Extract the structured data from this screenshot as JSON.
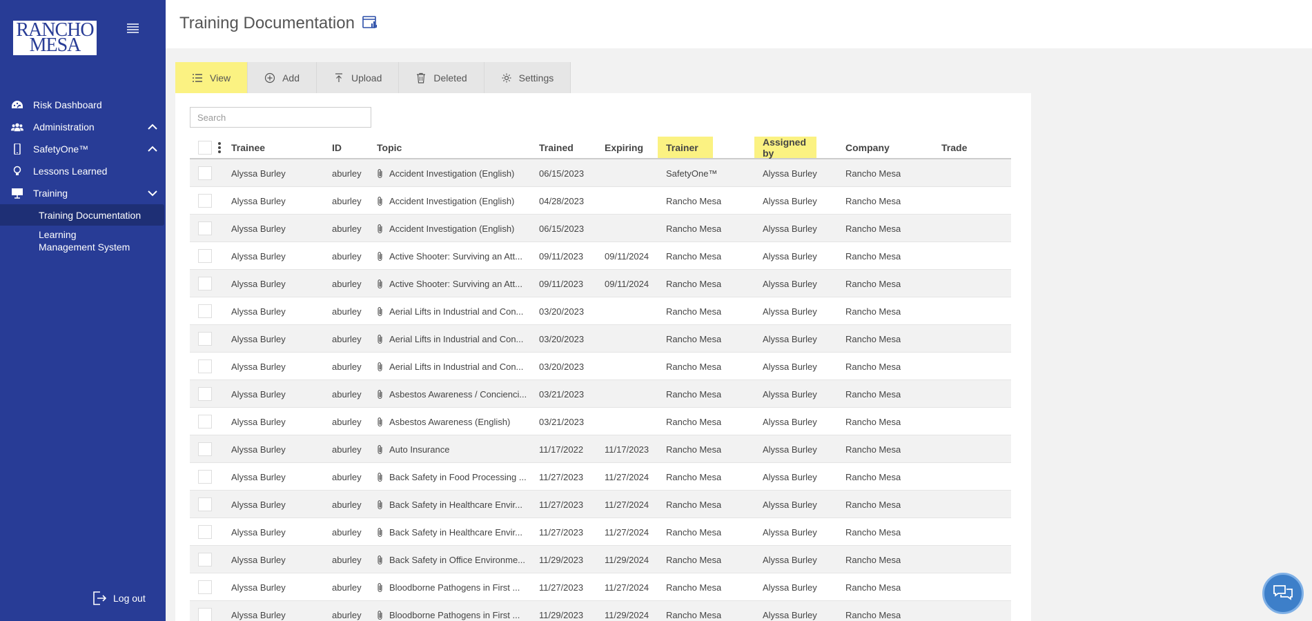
{
  "logo": {
    "line1": "RANCHO",
    "line2": "MESA"
  },
  "sidebar": {
    "items": [
      {
        "label": "Risk Dashboard",
        "icon": "dashboard-icon"
      },
      {
        "label": "Administration",
        "icon": "users-icon",
        "expanded": true
      },
      {
        "label": "SafetyOne™",
        "icon": "phone-icon",
        "expanded": true
      },
      {
        "label": "Lessons Learned",
        "icon": "lightbulb-icon"
      },
      {
        "label": "Training",
        "icon": "presentation-icon",
        "expanded": false
      }
    ],
    "training_sub": [
      {
        "label": "Training Documentation",
        "active": true
      },
      {
        "label": "Learning Management System",
        "active": false
      }
    ],
    "logout": "Log out"
  },
  "header": {
    "title": "Training Documentation"
  },
  "tabs": [
    {
      "label": "View",
      "icon": "list-icon",
      "active": true
    },
    {
      "label": "Add",
      "icon": "plus-circle-icon",
      "active": false
    },
    {
      "label": "Upload",
      "icon": "upload-icon",
      "active": false
    },
    {
      "label": "Deleted",
      "icon": "trash-icon",
      "active": false
    },
    {
      "label": "Settings",
      "icon": "gear-icon",
      "active": false
    }
  ],
  "search": {
    "placeholder": "Search",
    "value": ""
  },
  "table": {
    "columns": [
      "Trainee",
      "ID",
      "Topic",
      "Trained",
      "Expiring",
      "Trainer",
      "Assigned by",
      "Company",
      "Trade"
    ],
    "highlighted_columns": [
      "Trainer",
      "Assigned by"
    ],
    "highlight_color": "#fbf282",
    "rows": [
      [
        "Alyssa Burley",
        "aburley",
        "Accident Investigation (English)",
        "06/15/2023",
        "",
        "SafetyOne™",
        "Alyssa Burley",
        "Rancho Mesa",
        ""
      ],
      [
        "Alyssa Burley",
        "aburley",
        "Accident Investigation (English)",
        "04/28/2023",
        "",
        "Rancho Mesa",
        "Alyssa Burley",
        "Rancho Mesa",
        ""
      ],
      [
        "Alyssa Burley",
        "aburley",
        "Accident Investigation (English)",
        "06/15/2023",
        "",
        "Rancho Mesa",
        "Alyssa Burley",
        "Rancho Mesa",
        ""
      ],
      [
        "Alyssa Burley",
        "aburley",
        "Active Shooter: Surviving an Att...",
        "09/11/2023",
        "09/11/2024",
        "Rancho Mesa",
        "Alyssa Burley",
        "Rancho Mesa",
        ""
      ],
      [
        "Alyssa Burley",
        "aburley",
        "Active Shooter: Surviving an Att...",
        "09/11/2023",
        "09/11/2024",
        "Rancho Mesa",
        "Alyssa Burley",
        "Rancho Mesa",
        ""
      ],
      [
        "Alyssa Burley",
        "aburley",
        "Aerial Lifts in Industrial and Con...",
        "03/20/2023",
        "",
        "Rancho Mesa",
        "Alyssa Burley",
        "Rancho Mesa",
        ""
      ],
      [
        "Alyssa Burley",
        "aburley",
        "Aerial Lifts in Industrial and Con...",
        "03/20/2023",
        "",
        "Rancho Mesa",
        "Alyssa Burley",
        "Rancho Mesa",
        ""
      ],
      [
        "Alyssa Burley",
        "aburley",
        "Aerial Lifts in Industrial and Con...",
        "03/20/2023",
        "",
        "Rancho Mesa",
        "Alyssa Burley",
        "Rancho Mesa",
        ""
      ],
      [
        "Alyssa Burley",
        "aburley",
        "Asbestos Awareness / Concienci...",
        "03/21/2023",
        "",
        "Rancho Mesa",
        "Alyssa Burley",
        "Rancho Mesa",
        ""
      ],
      [
        "Alyssa Burley",
        "aburley",
        "Asbestos Awareness (English)",
        "03/21/2023",
        "",
        "Rancho Mesa",
        "Alyssa Burley",
        "Rancho Mesa",
        ""
      ],
      [
        "Alyssa Burley",
        "aburley",
        "Auto Insurance",
        "11/17/2022",
        "11/17/2023",
        "Rancho Mesa",
        "Alyssa Burley",
        "Rancho Mesa",
        ""
      ],
      [
        "Alyssa Burley",
        "aburley",
        "Back Safety in Food Processing ...",
        "11/27/2023",
        "11/27/2024",
        "Rancho Mesa",
        "Alyssa Burley",
        "Rancho Mesa",
        ""
      ],
      [
        "Alyssa Burley",
        "aburley",
        "Back Safety in Healthcare Envir...",
        "11/27/2023",
        "11/27/2024",
        "Rancho Mesa",
        "Alyssa Burley",
        "Rancho Mesa",
        ""
      ],
      [
        "Alyssa Burley",
        "aburley",
        "Back Safety in Healthcare Envir...",
        "11/27/2023",
        "11/27/2024",
        "Rancho Mesa",
        "Alyssa Burley",
        "Rancho Mesa",
        ""
      ],
      [
        "Alyssa Burley",
        "aburley",
        "Back Safety in Office Environme...",
        "11/29/2023",
        "11/29/2024",
        "Rancho Mesa",
        "Alyssa Burley",
        "Rancho Mesa",
        ""
      ],
      [
        "Alyssa Burley",
        "aburley",
        "Bloodborne Pathogens in First ...",
        "11/27/2023",
        "11/27/2024",
        "Rancho Mesa",
        "Alyssa Burley",
        "Rancho Mesa",
        ""
      ],
      [
        "Alyssa Burley",
        "aburley",
        "Bloodborne Pathogens in First ...",
        "11/29/2023",
        "11/29/2024",
        "Rancho Mesa",
        "Alyssa Burley",
        "Rancho Mesa",
        ""
      ]
    ]
  },
  "colors": {
    "sidebar": "#283c96",
    "sidebar_active": "#1e2f75",
    "accent": "#fbf282",
    "chat": "#3d7fc9"
  },
  "chat_button": {
    "icon": "chat-bubbles-icon"
  }
}
